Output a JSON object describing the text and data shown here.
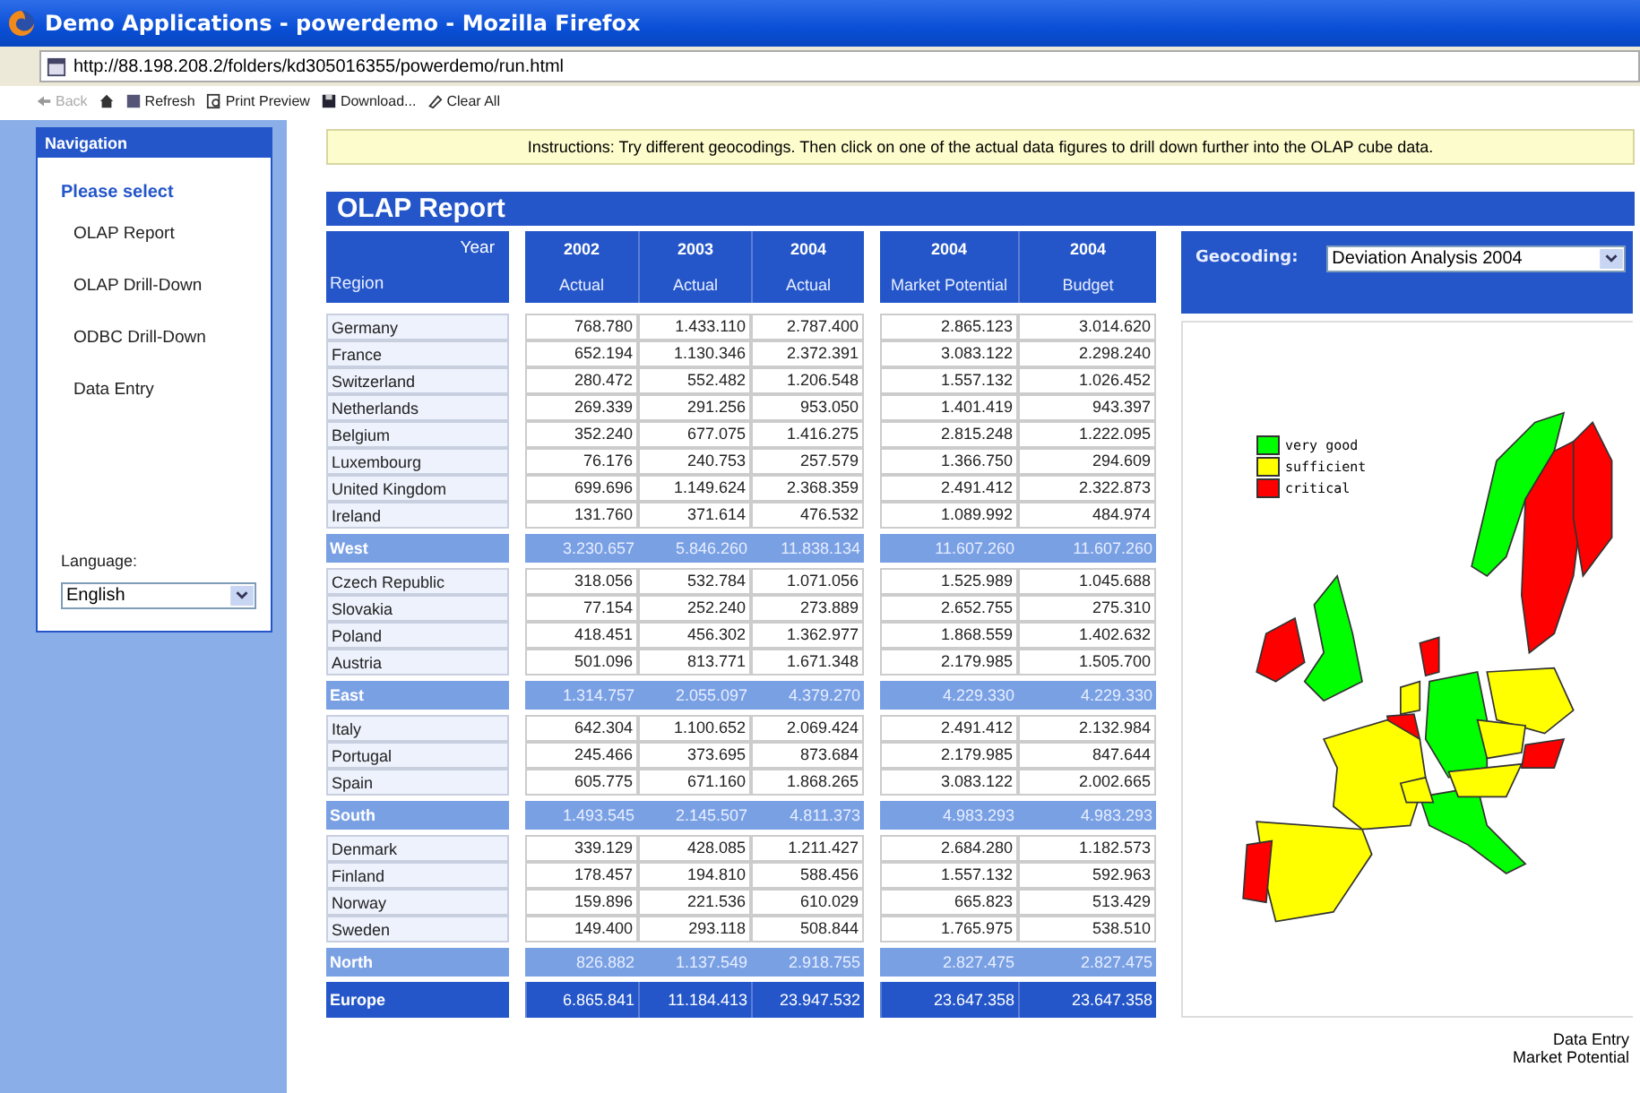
{
  "window": {
    "title": "Demo Applications -  powerdemo - Mozilla Firefox"
  },
  "address_bar": {
    "url": "http://88.198.208.2/folders/kd305016355/powerdemo/run.html"
  },
  "toolbar": [
    {
      "kind": "back",
      "label": "Back",
      "disabled": true
    },
    {
      "kind": "refresh",
      "label": "Refresh",
      "disabled": false
    },
    {
      "kind": "print",
      "label": "Print Preview",
      "disabled": false
    },
    {
      "kind": "download",
      "label": "Download...",
      "disabled": false
    },
    {
      "kind": "clear",
      "label": "Clear All",
      "disabled": false
    }
  ],
  "sidebar": {
    "title": "Navigation",
    "heading": "Please select",
    "items": [
      "OLAP Report",
      "OLAP Drill-Down",
      "ODBC Drill-Down",
      "Data Entry"
    ],
    "language_label": "Language:",
    "language_value": "English"
  },
  "instructions": "Instructions: Try different geocodings. Then click on one of the actual data figures to drill down further into the OLAP cube data.",
  "report": {
    "title": "OLAP Report",
    "corner": {
      "top": "Year",
      "bottom": "Region"
    },
    "column_groups": [
      [
        {
          "year": "2002",
          "measure": "Actual"
        },
        {
          "year": "2003",
          "measure": "Actual"
        },
        {
          "year": "2004",
          "measure": "Actual"
        }
      ],
      [
        {
          "year": "2004",
          "measure": "Market Potential"
        },
        {
          "year": "2004",
          "measure": "Budget"
        }
      ]
    ],
    "rows": [
      {
        "kind": "country",
        "label": "Germany",
        "values": [
          "768.780",
          "1.433.110",
          "2.787.400",
          "2.865.123",
          "3.014.620"
        ]
      },
      {
        "kind": "country",
        "label": "France",
        "values": [
          "652.194",
          "1.130.346",
          "2.372.391",
          "3.083.122",
          "2.298.240"
        ]
      },
      {
        "kind": "country",
        "label": "Switzerland",
        "values": [
          "280.472",
          "552.482",
          "1.206.548",
          "1.557.132",
          "1.026.452"
        ]
      },
      {
        "kind": "country",
        "label": "Netherlands",
        "values": [
          "269.339",
          "291.256",
          "953.050",
          "1.401.419",
          "943.397"
        ]
      },
      {
        "kind": "country",
        "label": "Belgium",
        "values": [
          "352.240",
          "677.075",
          "1.416.275",
          "2.815.248",
          "1.222.095"
        ]
      },
      {
        "kind": "country",
        "label": "Luxembourg",
        "values": [
          "76.176",
          "240.753",
          "257.579",
          "1.366.750",
          "294.609"
        ]
      },
      {
        "kind": "country",
        "label": "United Kingdom",
        "values": [
          "699.696",
          "1.149.624",
          "2.368.359",
          "2.491.412",
          "2.322.873"
        ]
      },
      {
        "kind": "country",
        "label": "Ireland",
        "values": [
          "131.760",
          "371.614",
          "476.532",
          "1.089.992",
          "484.974"
        ]
      },
      {
        "kind": "subtotal",
        "label": "West",
        "values": [
          "3.230.657",
          "5.846.260",
          "11.838.134",
          "11.607.260",
          "11.607.260"
        ]
      },
      {
        "kind": "country",
        "label": "Czech Republic",
        "values": [
          "318.056",
          "532.784",
          "1.071.056",
          "1.525.989",
          "1.045.688"
        ]
      },
      {
        "kind": "country",
        "label": "Slovakia",
        "values": [
          "77.154",
          "252.240",
          "273.889",
          "2.652.755",
          "275.310"
        ]
      },
      {
        "kind": "country",
        "label": "Poland",
        "values": [
          "418.451",
          "456.302",
          "1.362.977",
          "1.868.559",
          "1.402.632"
        ]
      },
      {
        "kind": "country",
        "label": "Austria",
        "values": [
          "501.096",
          "813.771",
          "1.671.348",
          "2.179.985",
          "1.505.700"
        ]
      },
      {
        "kind": "subtotal",
        "label": "East",
        "values": [
          "1.314.757",
          "2.055.097",
          "4.379.270",
          "4.229.330",
          "4.229.330"
        ]
      },
      {
        "kind": "country",
        "label": "Italy",
        "values": [
          "642.304",
          "1.100.652",
          "2.069.424",
          "2.491.412",
          "2.132.984"
        ]
      },
      {
        "kind": "country",
        "label": "Portugal",
        "values": [
          "245.466",
          "373.695",
          "873.684",
          "2.179.985",
          "847.644"
        ]
      },
      {
        "kind": "country",
        "label": "Spain",
        "values": [
          "605.775",
          "671.160",
          "1.868.265",
          "3.083.122",
          "2.002.665"
        ]
      },
      {
        "kind": "subtotal",
        "label": "South",
        "values": [
          "1.493.545",
          "2.145.507",
          "4.811.373",
          "4.983.293",
          "4.983.293"
        ]
      },
      {
        "kind": "country",
        "label": "Denmark",
        "values": [
          "339.129",
          "428.085",
          "1.211.427",
          "2.684.280",
          "1.182.573"
        ]
      },
      {
        "kind": "country",
        "label": "Finland",
        "values": [
          "178.457",
          "194.810",
          "588.456",
          "1.557.132",
          "592.963"
        ]
      },
      {
        "kind": "country",
        "label": "Norway",
        "values": [
          "159.896",
          "221.536",
          "610.029",
          "665.823",
          "513.429"
        ]
      },
      {
        "kind": "country",
        "label": "Sweden",
        "values": [
          "149.400",
          "293.118",
          "508.844",
          "1.765.975",
          "538.510"
        ]
      },
      {
        "kind": "subtotal",
        "label": "North",
        "values": [
          "826.882",
          "1.137.549",
          "2.918.755",
          "2.827.475",
          "2.827.475"
        ]
      },
      {
        "kind": "total",
        "label": "Europe",
        "values": [
          "6.865.841",
          "11.184.413",
          "23.947.532",
          "23.647.358",
          "23.647.358"
        ]
      }
    ]
  },
  "geocoding": {
    "label": "Geocoding:",
    "value": "Deviation Analysis 2004",
    "legend": [
      {
        "label": "very good",
        "color": "#00ff00"
      },
      {
        "label": "sufficient",
        "color": "#ffff00"
      },
      {
        "label": "critical",
        "color": "#ff0000"
      }
    ],
    "footer": [
      "Data Entry",
      "Market Potential"
    ]
  }
}
